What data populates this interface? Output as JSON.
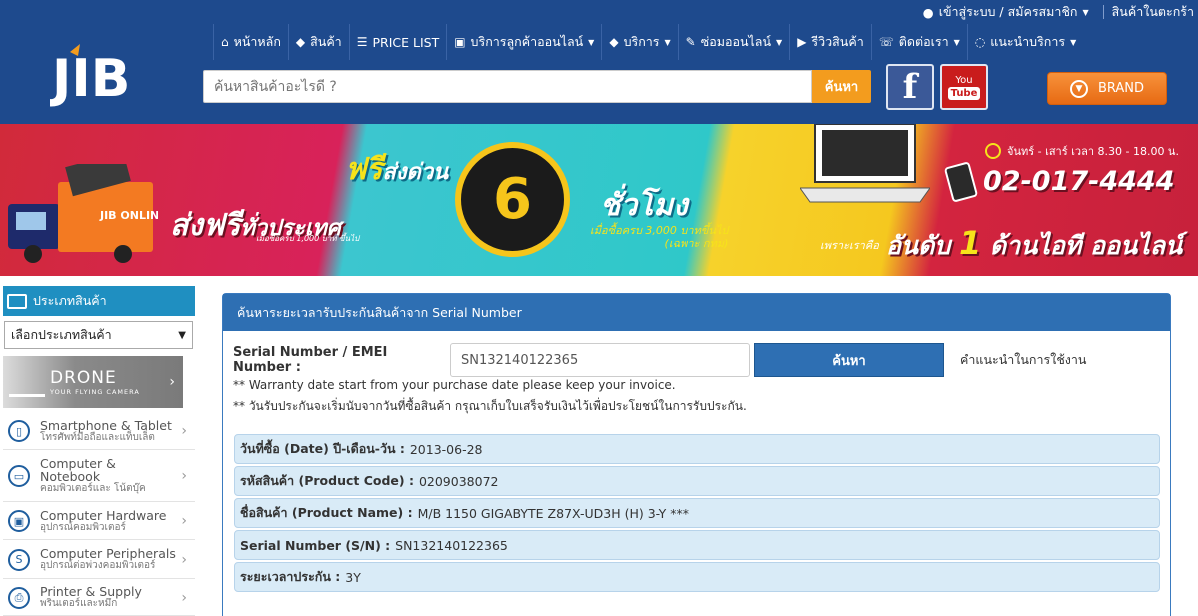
{
  "topbar": {
    "login_label": "เข้าสู่ระบบ / สมัครสมาชิก",
    "cart_label": "สินค้าในตะกร้า"
  },
  "header": {
    "logo_text": "JIB",
    "nav": [
      {
        "icon": "home-icon",
        "glyph": "⌂",
        "label": "หน้าหลัก",
        "caret": false
      },
      {
        "icon": "tag-icon",
        "glyph": "◆",
        "label": "สินค้า",
        "caret": false
      },
      {
        "icon": "list-icon",
        "glyph": "☰",
        "label": "PRICE LIST",
        "caret": false
      },
      {
        "icon": "cart-icon",
        "glyph": "▣",
        "label": "บริการลูกค้าออนไลน์",
        "caret": true
      },
      {
        "icon": "tag-icon",
        "glyph": "◆",
        "label": "บริการ",
        "caret": true
      },
      {
        "icon": "wrench-icon",
        "glyph": "✎",
        "label": "ซ่อมออนไลน์",
        "caret": true
      },
      {
        "icon": "video-icon",
        "glyph": "▶",
        "label": "รีวิวสินค้า",
        "caret": false
      },
      {
        "icon": "phone-icon",
        "glyph": "☏",
        "label": "ติดต่อเรา",
        "caret": true
      },
      {
        "icon": "chat-icon",
        "glyph": "◌",
        "label": "แนะนำบริการ",
        "caret": true
      }
    ],
    "search_placeholder": "ค้นหาสินค้าอะไรดี ?",
    "search_button": "ค้นหา",
    "facebook_label": "f",
    "youtube_label_top": "You",
    "youtube_label_bottom": "Tube",
    "brand_button": "BRAND"
  },
  "banner": {
    "free_shipping": "ส่งฟรี",
    "free_shipping_2": "ทั่วประเทศ",
    "free_shipping_note": "เมื่อซื้อครบ 1,000 บาท ขึ้นไป",
    "truck_text": "JIB ONLINE",
    "express_free": "ฟรี",
    "express_label": "ส่งด่วน",
    "express_hours": "6",
    "express_unit": "ชั่วโมง",
    "express_note_1": "เมื่อซื้อครบ 3,000 บาทขึ้นไป",
    "express_note_2": "(เฉพาะ กทม)",
    "office_hours": "จันทร์ - เสาร์ เวลา 8.30 - 18.00 น.",
    "phone": "02-017-4444",
    "rank_prefix": "เพราะเราคือ",
    "rank_1": "อันดับ",
    "rank_num": "1",
    "rank_2": "ด้านไอที ออนไลน์"
  },
  "sidebar": {
    "category_header": "ประเภทสินค้า",
    "category_select": "เลือกประเภทสินค้า",
    "drone_title": "DRONE",
    "drone_sub": "YOUR FLYING CAMERA",
    "items": [
      {
        "title": "Smartphone & Tablet",
        "subtitle": "โทรศัพท์มือถือและแท็บเล็ต",
        "icon": "smartphone-icon",
        "glyph": "▯"
      },
      {
        "title": "Computer &",
        "title2": "Notebook",
        "subtitle": "คอมพิวเตอร์และ โน้ตบุ๊ค",
        "icon": "notebook-icon",
        "glyph": "▭"
      },
      {
        "title": "Computer Hardware",
        "subtitle": "อุปกรณ์คอมพิวเตอร์",
        "icon": "hardware-icon",
        "glyph": "▣"
      },
      {
        "title": "Computer Peripherals",
        "subtitle": "อุปกรณ์ต่อพ่วงคอมพิวเตอร์",
        "icon": "peripherals-icon",
        "glyph": "S"
      },
      {
        "title": "Printer & Supply",
        "subtitle": "พรินเตอร์และหมึก",
        "icon": "printer-icon",
        "glyph": "⎙"
      }
    ]
  },
  "panel": {
    "title": "ค้นหาระยะเวลารับประกันสินค้าจาก Serial Number",
    "sn_label": "Serial Number / EMEI Number :",
    "sn_value": "SN132140122365",
    "sn_button": "ค้นหา",
    "help_link": "คำแนะนำในการใช้งาน",
    "note_1": "** Warranty date start from your purchase date please keep your invoice.",
    "note_2": "** วันรับประกันจะเริ่มนับจากวันที่ซื้อสินค้า กรุณาเก็บใบเสร็จรับเงินไว้เพื่อประโยชน์ในการรับประกัน.",
    "results": [
      {
        "label": "วันที่ซื้อ (Date) ปี-เดือน-วัน :",
        "value": "2013-06-28"
      },
      {
        "label": "รหัสสินค้า (Product Code) :",
        "value": "0209038072"
      },
      {
        "label": "ชื่อสินค้า (Product Name) :",
        "value": "M/B 1150 GIGABYTE Z87X-UD3H (H) 3-Y ***"
      },
      {
        "label": "Serial Number (S/N) :",
        "value": "SN132140122365"
      },
      {
        "label": "ระยะเวลาประกัน :",
        "value": "3Y"
      }
    ]
  },
  "colors": {
    "header_blue": "#1e4a8d",
    "accent_orange": "#f39c1e",
    "panel_blue": "#2e6fb3",
    "sidebar_head": "#1f8fc1",
    "result_bg": "#d9ebf7"
  }
}
